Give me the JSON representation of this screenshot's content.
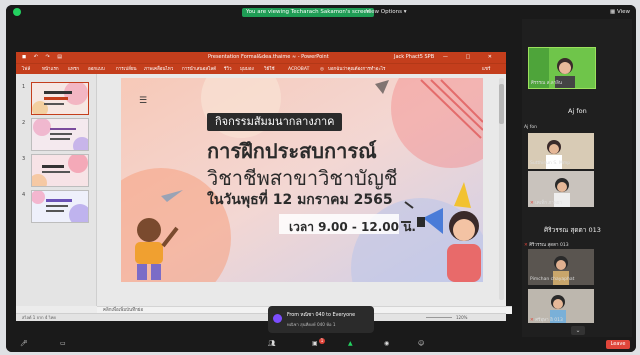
{
  "zoom": {
    "share_banner": "You are viewing Techarach Sakamon's screen",
    "view_options": "View Options ▾",
    "view_label": "View",
    "leave_label": "Leave",
    "chat_badge": "1"
  },
  "ppt": {
    "doc_title": "Presentation Formal&dea.thaime ≈ - PowerPoint",
    "user": "Jack Phact5 SPB",
    "win_buttons": "— □ ✕",
    "ribbon_tabs": [
      "ไฟล์",
      "หน้าแรก",
      "แทรก",
      "ออกแบบ",
      "การเปลี่ยน",
      "ภาพเคลื่อนไหว",
      "การนำเสนอสไลด์",
      "รีวิว",
      "มุมมอง",
      "วิธีใช้",
      "ACROBAT",
      "บอกฉันว่าคุณต้องการทำอะไร"
    ],
    "share": "แชร์",
    "notes_placeholder": "คลิกเพื่อเพิ่มบันทึกย่อ",
    "status_left": "สไลด์ 1 จาก 4   ไทย",
    "zoom_level": "120%",
    "thumb_numbers": [
      "1",
      "2",
      "3",
      "4"
    ]
  },
  "slide": {
    "kicker": "กิจกรรมสัมมนากลางภาค",
    "line1": "การฝึกประสบการณ์",
    "line2": "วิชาชีพสาขาวิชาบัญชี",
    "line3": "ในวันพุธที่ 12 มกราคม 2565",
    "time": "เวลา 9.00 - 12.00 น."
  },
  "participants": {
    "top_name": "ศิรรรณ ส.ลาลิน",
    "aj_fon": "Aj fon",
    "aj_sub": "Aj fon",
    "p2": "Sutthinun S. Mmp",
    "p3": "เคเท็ก ภาพยา",
    "bigname": "ศิริวรรณ สุดตา 013",
    "p4": "ศิริวรรณ สุดตา 013",
    "p5": "Pimchan chayaphat",
    "p6": "ศรีอุษา อิ 013"
  },
  "chat": {
    "from": "From หณิชา 040 to Everyone",
    "msg": "หณิชา สุนทียงษ์ 040 ห้อ 1"
  },
  "colors": {
    "ppt_accent": "#c43e1c",
    "zoom_green": "#23d160",
    "leave_red": "#e0453a"
  }
}
